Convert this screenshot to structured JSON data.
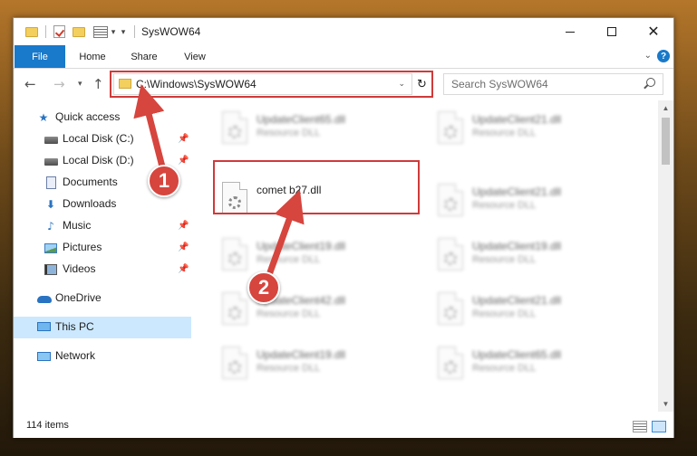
{
  "window": {
    "title": "SysWOW64"
  },
  "ribbon": {
    "tabs": [
      {
        "label": "File"
      },
      {
        "label": "Home"
      },
      {
        "label": "Share"
      },
      {
        "label": "View"
      }
    ]
  },
  "address": {
    "path": "C:\\Windows\\SysWOW64"
  },
  "search": {
    "placeholder": "Search SysWOW64"
  },
  "nav": {
    "items": [
      {
        "label": "Quick access",
        "icon": "star-icon",
        "pinned": false
      },
      {
        "label": "Local Disk (C:)",
        "icon": "drive-icon",
        "pinned": true
      },
      {
        "label": "Local Disk (D:)",
        "icon": "drive-icon",
        "pinned": true
      },
      {
        "label": "Documents",
        "icon": "documents-icon",
        "pinned": true
      },
      {
        "label": "Downloads",
        "icon": "download-icon",
        "pinned": true
      },
      {
        "label": "Music",
        "icon": "music-icon",
        "pinned": true
      },
      {
        "label": "Pictures",
        "icon": "pictures-icon",
        "pinned": true
      },
      {
        "label": "Videos",
        "icon": "videos-icon",
        "pinned": true
      },
      {
        "label": "OneDrive",
        "icon": "cloud-icon",
        "pinned": false
      },
      {
        "label": "This PC",
        "icon": "computer-icon",
        "pinned": false,
        "selected": true
      },
      {
        "label": "Network",
        "icon": "network-icon",
        "pinned": false
      }
    ]
  },
  "files": {
    "highlighted": {
      "name": "comet b27.dll"
    },
    "blurred": [
      {
        "name": "UpdateClient65.dll",
        "type": "Resource DLL"
      },
      {
        "name": "UpdateClient21.dll",
        "type": "Resource DLL"
      },
      {
        "name": "UpdateClient21.dll",
        "type": "Resource DLL"
      },
      {
        "name": "UpdateClient19.dll",
        "type": "Resource DLL"
      },
      {
        "name": "UpdateClient19.dll",
        "type": "Resource DLL"
      },
      {
        "name": "UpdateClient42.dll",
        "type": "Resource DLL"
      },
      {
        "name": "UpdateClient21.dll",
        "type": "Resource DLL"
      },
      {
        "name": "UpdateClient19.dll",
        "type": "Resource DLL"
      },
      {
        "name": "UpdateClient65.dll",
        "type": "Resource DLL"
      }
    ]
  },
  "status": {
    "item_count": "114 items"
  },
  "annotations": [
    {
      "number": "1"
    },
    {
      "number": "2"
    }
  ],
  "colors": {
    "accent": "#1979ca",
    "highlight": "#d03a3a",
    "selected": "#cce8ff"
  }
}
